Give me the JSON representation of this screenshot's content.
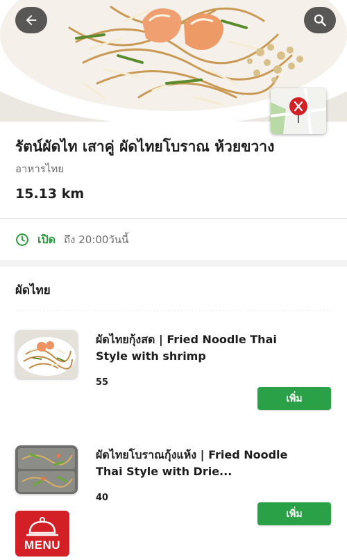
{
  "restaurant": {
    "name": "รัตน์ผัดไท เสาคู่ ผัดไทยโบราณ ห้วยขวาง",
    "cuisine": "อาหารไทย",
    "distance": "15.13 km"
  },
  "hours": {
    "status": "เปิด",
    "detail": "ถึง 20:00วันนี้",
    "status_color": "#2a9d3e"
  },
  "icons": {
    "back": "back-arrow-icon",
    "search": "search-icon",
    "map": "map-pin-icon",
    "clock": "clock-icon",
    "menu": "menu-cloche-icon"
  },
  "section": {
    "title": "ผัดไทย"
  },
  "items": [
    {
      "name": "ผัดไทยกุ้งสด | Fried Noodle Thai Style with shrimp",
      "price": "55",
      "add_label": "เพิ่ม"
    },
    {
      "name": "ผัดไทยโบราณกุ้งแห้ง | Fried Noodle Thai Style with Drie...",
      "price": "40",
      "add_label": "เพิ่ม"
    }
  ],
  "menu_badge": {
    "label": "MENU"
  },
  "colors": {
    "accent_green": "#2aa047",
    "brand_red": "#d32027"
  }
}
